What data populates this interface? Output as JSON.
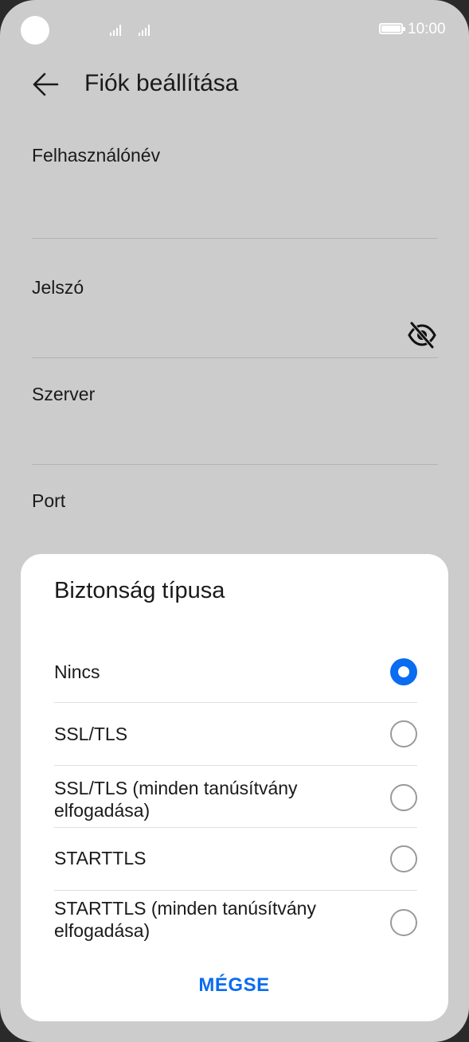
{
  "status_bar": {
    "time": "10:00",
    "icons": [
      "camera-cutout",
      "signal-icon",
      "signal-icon",
      "battery-icon"
    ]
  },
  "header": {
    "title": "Fiók beállítása",
    "back_icon": "arrow-left-icon"
  },
  "form": {
    "username_label": "Felhasználónév",
    "password_label": "Jelszó",
    "password_toggle_icon": "eye-off-icon",
    "server_label": "Szerver",
    "port_label": "Port"
  },
  "dialog": {
    "title": "Biztonság típusa",
    "options": [
      {
        "label": "Nincs",
        "selected": true
      },
      {
        "label": "SSL/TLS",
        "selected": false
      },
      {
        "label": "SSL/TLS (minden tanúsítvány elfogadása)",
        "selected": false
      },
      {
        "label": "STARTTLS",
        "selected": false
      },
      {
        "label": "STARTTLS (minden tanúsítvány elfogadása)",
        "selected": false
      }
    ],
    "cancel_label": "MÉGSE"
  },
  "colors": {
    "background": "#cccccc",
    "accent": "#0a6cf0",
    "dialog": "#ffffff"
  }
}
